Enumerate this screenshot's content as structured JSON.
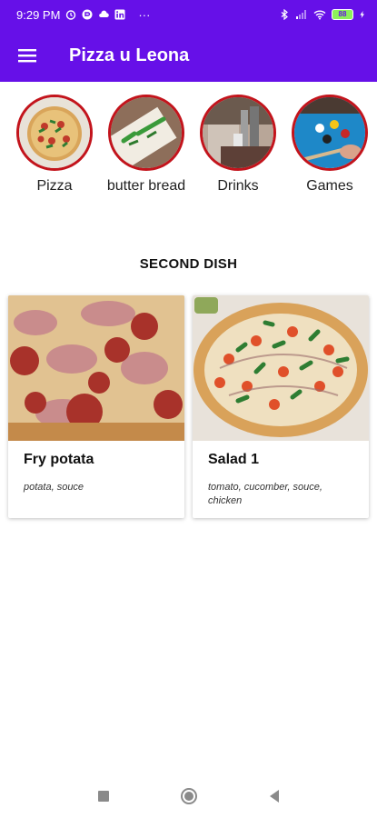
{
  "status_bar": {
    "time": "9:29 PM",
    "more": "···",
    "battery": "88"
  },
  "app_bar": {
    "title": "Pizza u Leona"
  },
  "categories": [
    {
      "label": "Pizza",
      "icon": "pizza-photo"
    },
    {
      "label": "butter bread",
      "icon": "bread-photo"
    },
    {
      "label": "Drinks",
      "icon": "drinks-photo"
    },
    {
      "label": "Games",
      "icon": "billiards-photo"
    }
  ],
  "section": {
    "title": "SECOND DISH"
  },
  "dishes": [
    {
      "name": "Fry potata",
      "description": "potata, souce",
      "image": "salami-pizza-photo"
    },
    {
      "name": "Salad 1",
      "description": "tomato, cucomber, souce, chicken",
      "image": "tomato-pizza-photo"
    }
  ],
  "colors": {
    "primary": "#6610e8",
    "category_border": "#c3141c"
  }
}
